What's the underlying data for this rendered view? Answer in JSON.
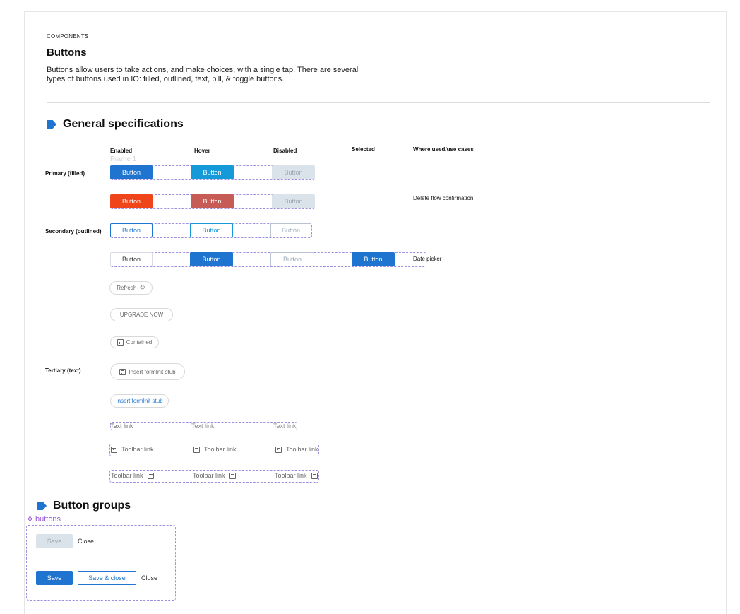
{
  "header": {
    "eyebrow": "COMPONENTS",
    "title": "Buttons",
    "description": "Buttons allow users to take actions, and make choices, with a single tap. There are several types of buttons used in IO: filled, outlined, text, pill, & toggle buttons."
  },
  "general": {
    "title": "General specifications",
    "columns": {
      "enabled": "Enabled",
      "hover": "Hover",
      "disabled": "Disabled",
      "selected": "Selected",
      "where": "Where used/use cases"
    },
    "frame_label": "Frame 1",
    "rows": {
      "primary": "Primary (filled)",
      "secondary": "Secondary (outlined)",
      "tertiary": "Tertiary (text)"
    },
    "button_label": "Button",
    "notes": {
      "delete": "Delete flow confirmation",
      "date": "Date picker"
    },
    "pills": {
      "refresh": "Refresh",
      "upgrade": "UPGRADE NOW",
      "contained": "Contained",
      "insert_icon": "Insert formInit stub",
      "insert_blue": "Insert formInit stub"
    },
    "text_link": "Text link",
    "toolbar_link": "Toolbar link"
  },
  "groups": {
    "title": "Button groups",
    "component_label": "buttons",
    "save": "Save",
    "close": "Close",
    "save_close": "Save & close"
  },
  "colors": {
    "primary": "#1f74cf",
    "hover": "#149ad9",
    "danger": "#f0451a",
    "danger_hover": "#c75b55",
    "disabled": "#dbe3ea",
    "component_purple": "#9b59d8"
  }
}
